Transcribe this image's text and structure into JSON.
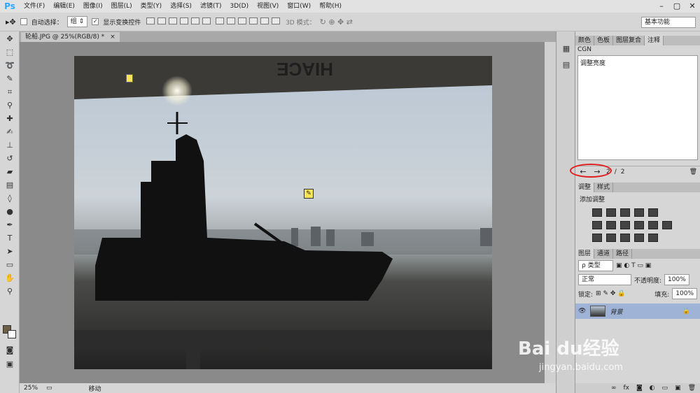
{
  "app": {
    "logo": "Ps"
  },
  "menu": [
    "文件(F)",
    "编辑(E)",
    "图像(I)",
    "图层(L)",
    "类型(Y)",
    "选择(S)",
    "滤镜(T)",
    "3D(D)",
    "视图(V)",
    "窗口(W)",
    "帮助(H)"
  ],
  "window_controls": [
    "–",
    "▢",
    "✕"
  ],
  "options": {
    "auto_select": "自动选择：",
    "group": "组",
    "transform": "显示变换控件",
    "mode3d": "3D 模式：",
    "workspace": "基本功能"
  },
  "document": {
    "tab": "轮船.JPG @ 25%(RGB/8) *",
    "close": "×"
  },
  "status": {
    "zoom": "25%",
    "tool": "移动"
  },
  "notes": {
    "tabs": [
      "颜色",
      "色板",
      "图层复合",
      "注释"
    ],
    "author": "CGN",
    "text": "调整亮度",
    "page_current": "2",
    "page_sep": "/",
    "page_total": "2",
    "prev": "←",
    "next": "→"
  },
  "adjustments": {
    "tabs": [
      "调整",
      "样式"
    ],
    "title": "添加调整"
  },
  "layers": {
    "tabs": [
      "图层",
      "通道",
      "路径"
    ],
    "filter": "ρ 类型",
    "blend": "正常",
    "opacity_label": "不透明度:",
    "opacity": "100%",
    "lock_label": "锁定:",
    "fill_label": "填充:",
    "fill": "100%",
    "layer_name": "背景"
  },
  "photo_text": {
    "sign": "HIACE"
  },
  "watermark": {
    "brand": "Bai du经验",
    "url": "jingyan.baidu.com"
  }
}
